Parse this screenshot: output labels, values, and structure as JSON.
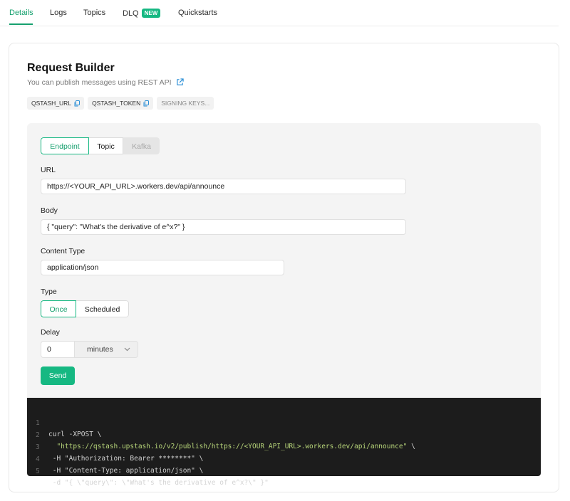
{
  "tabs": [
    {
      "label": "Details",
      "active": true
    },
    {
      "label": "Logs"
    },
    {
      "label": "Topics"
    },
    {
      "label": "DLQ",
      "badge": "NEW"
    },
    {
      "label": "Quickstarts"
    }
  ],
  "header": {
    "title": "Request Builder",
    "subtitle": "You can publish messages using REST API"
  },
  "chips": [
    {
      "label": "QSTASH_URL",
      "icon": "copy-icon"
    },
    {
      "label": "QSTASH_TOKEN",
      "icon": "copy-icon"
    },
    {
      "label": "SIGNING KEYS..."
    }
  ],
  "destination_tabs": [
    "Endpoint",
    "Topic",
    "Kafka"
  ],
  "form": {
    "url_label": "URL",
    "url_value": "https://<YOUR_API_URL>.workers.dev/api/announce",
    "body_label": "Body",
    "body_value": "{ \"query\": \"What's the derivative of e^x?\" }",
    "content_type_label": "Content Type",
    "content_type_value": "application/json",
    "type_label": "Type",
    "type_options": [
      "Once",
      "Scheduled"
    ],
    "delay_label": "Delay",
    "delay_value": "0",
    "delay_unit": "minutes",
    "send_label": "Send"
  },
  "code": {
    "lines": [
      {
        "n": "1",
        "text": "curl -XPOST \\"
      },
      {
        "n": "2",
        "str": "\"https://qstash.upstash.io/v2/publish/https://<YOUR_API_URL>.workers.dev/api/announce\"",
        "after": " \\"
      },
      {
        "n": "3",
        "text": " -H \"Authorization: Bearer ********\" \\"
      },
      {
        "n": "4",
        "text": " -H \"Content-Type: application/json\" \\"
      },
      {
        "n": "5",
        "text": " -d \"{ \\\"query\\\": \\\"What's the derivative of e^x?\\\" }\""
      }
    ]
  },
  "colors": {
    "accent": "#16b882",
    "code_bg": "#1c1c1c",
    "code_string": "#b8d67a"
  }
}
